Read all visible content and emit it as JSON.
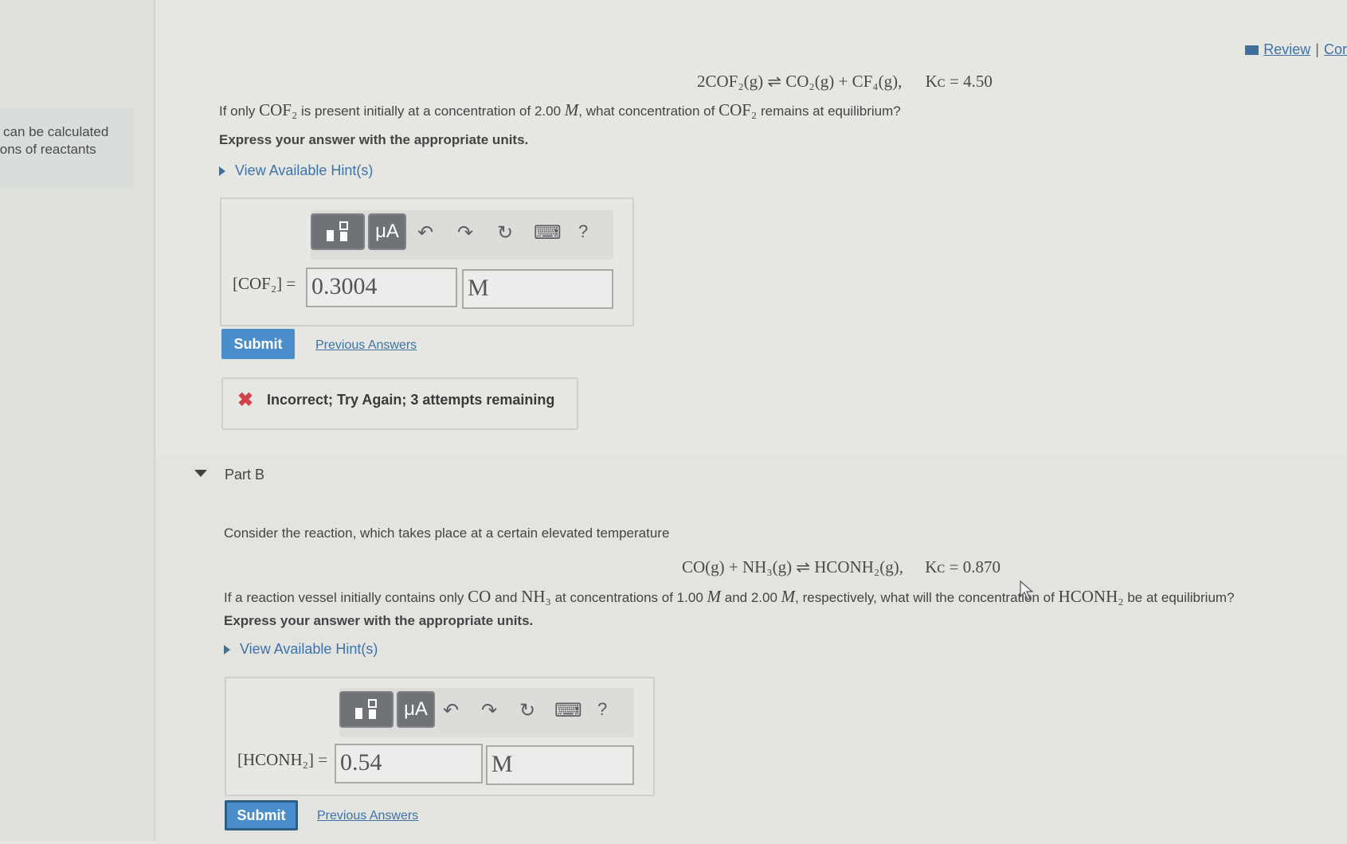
{
  "left_note": {
    "line1": "can be calculated",
    "line2": "ions of reactants"
  },
  "top_links": {
    "review": "Review",
    "separator": "|",
    "cor": "Cor"
  },
  "part_a": {
    "equation_left": "2COF",
    "equation": "2COF₂(g) ⇌ CO₂(g) + CF₄(g),",
    "kc": "Kᴄ = 4.50",
    "question_1": "If only",
    "species": "COF₂",
    "question_2": "is present initially at a concentration of 2.00",
    "unit_M": "M",
    "question_3": ", what concentration of",
    "question_4": "remains at equilibrium?",
    "instruction": "Express your answer with the appropriate units.",
    "hint": "View Available Hint(s)",
    "answer_label": "[COF₂] =",
    "answer_value": "0.3004",
    "answer_unit": "M",
    "submit": "Submit",
    "previous": "Previous Answers",
    "feedback": "Incorrect; Try Again; 3 attempts remaining",
    "feedback_mark": "✖"
  },
  "toolbar": {
    "units_label": "μA",
    "help": "?",
    "undo": "↶",
    "redo": "↷",
    "reset": "↻",
    "keyboard": "⌨"
  },
  "part_b": {
    "title": "Part B",
    "intro": "Consider the reaction, which takes place at a certain elevated temperature",
    "equation": "CO(g) + NH₃(g) ⇌ HCONH₂(g),",
    "kc": "Kᴄ = 0.870",
    "question_1": "If a reaction vessel initially contains only",
    "co": "CO",
    "and": "and",
    "nh3": "NH₃",
    "question_2": "at concentrations of 1.00",
    "unit_M": "M",
    "and2": "and 2.00",
    "question_3": ", respectively, what will the concentration of",
    "hconh2": "HCONH₂",
    "question_4": "be at equilibrium?",
    "instruction": "Express your answer with the appropriate units.",
    "hint": "View Available Hint(s)",
    "answer_label": "[HCONH₂] =",
    "answer_value": "0.54",
    "answer_unit": "M",
    "submit": "Submit",
    "previous": "Previous Answers"
  }
}
